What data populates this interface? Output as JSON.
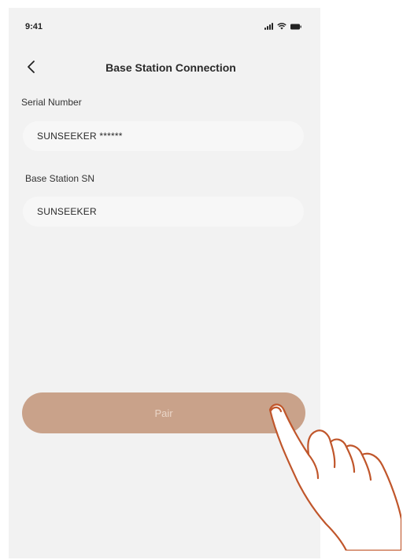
{
  "status_bar": {
    "time": "9:41",
    "icons": [
      "signal-icon",
      "wifi-icon",
      "battery-icon"
    ]
  },
  "header": {
    "title": "Base Station Connection",
    "back_icon": "chevron-left-icon"
  },
  "form": {
    "serial_number": {
      "label": "Serial Number",
      "value": "SUNSEEKER ******"
    },
    "base_station_sn": {
      "label": "Base Station SN",
      "value": "SUNSEEKER"
    }
  },
  "actions": {
    "pair_label": "Pair"
  },
  "colors": {
    "screen_background": "#f2f2f2",
    "input_background": "#f7f7f7",
    "button_background": "#c9a28a",
    "button_text": "#ead6c8",
    "hand_stroke": "#c0562b"
  },
  "overlay": {
    "icon": "pointing-hand-icon"
  }
}
